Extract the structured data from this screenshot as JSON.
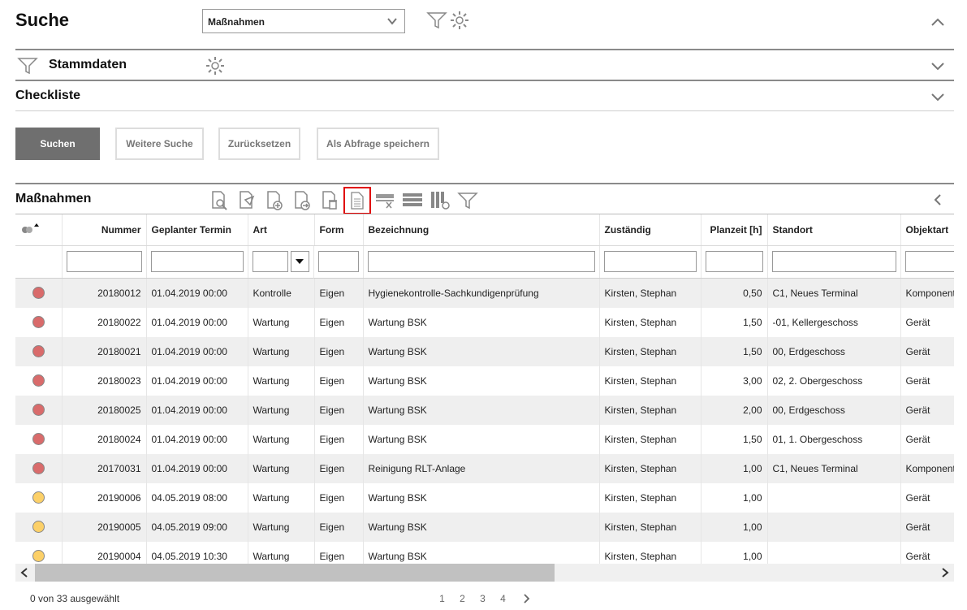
{
  "header": {
    "title": "Suche",
    "select_value": "Maßnahmen"
  },
  "sections": {
    "stammdaten": "Stammdaten",
    "checkliste": "Checkliste"
  },
  "buttons": {
    "suchen": "Suchen",
    "weitere": "Weitere Suche",
    "reset": "Zurücksetzen",
    "save": "Als Abfrage speichern"
  },
  "results": {
    "title": "Maßnahmen",
    "columns": [
      "",
      "Nummer",
      "Geplanter Termin",
      "Art",
      "Form",
      "Bezeichnung",
      "Zuständig",
      "Planzeit [h]",
      "Standort",
      "Objektart"
    ],
    "rows": [
      {
        "status": "red",
        "nummer": "20180012",
        "termin": "01.04.2019 00:00",
        "art": "Kontrolle",
        "form": "Eigen",
        "bez": "Hygienekontrolle-Sachkundigenprüfung",
        "zust": "Kirsten, Stephan",
        "plan": "0,50",
        "standort": "C1, Neues Terminal",
        "objektart": "Komponente"
      },
      {
        "status": "red",
        "nummer": "20180022",
        "termin": "01.04.2019 00:00",
        "art": "Wartung",
        "form": "Eigen",
        "bez": "Wartung BSK",
        "zust": "Kirsten, Stephan",
        "plan": "1,50",
        "standort": "-01, Kellergeschoss",
        "objektart": "Gerät"
      },
      {
        "status": "red",
        "nummer": "20180021",
        "termin": "01.04.2019 00:00",
        "art": "Wartung",
        "form": "Eigen",
        "bez": "Wartung BSK",
        "zust": "Kirsten, Stephan",
        "plan": "1,50",
        "standort": "00, Erdgeschoss",
        "objektart": "Gerät"
      },
      {
        "status": "red",
        "nummer": "20180023",
        "termin": "01.04.2019 00:00",
        "art": "Wartung",
        "form": "Eigen",
        "bez": "Wartung BSK",
        "zust": "Kirsten, Stephan",
        "plan": "3,00",
        "standort": "02, 2. Obergeschoss",
        "objektart": "Gerät"
      },
      {
        "status": "red",
        "nummer": "20180025",
        "termin": "01.04.2019 00:00",
        "art": "Wartung",
        "form": "Eigen",
        "bez": "Wartung BSK",
        "zust": "Kirsten, Stephan",
        "plan": "2,00",
        "standort": "00, Erdgeschoss",
        "objektart": "Gerät"
      },
      {
        "status": "red",
        "nummer": "20180024",
        "termin": "01.04.2019 00:00",
        "art": "Wartung",
        "form": "Eigen",
        "bez": "Wartung BSK",
        "zust": "Kirsten, Stephan",
        "plan": "1,50",
        "standort": "01, 1. Obergeschoss",
        "objektart": "Gerät"
      },
      {
        "status": "red",
        "nummer": "20170031",
        "termin": "01.04.2019 00:00",
        "art": "Wartung",
        "form": "Eigen",
        "bez": "Reinigung RLT-Anlage",
        "zust": "Kirsten, Stephan",
        "plan": "1,00",
        "standort": "C1, Neues Terminal",
        "objektart": "Komponente"
      },
      {
        "status": "yellow",
        "nummer": "20190006",
        "termin": "04.05.2019 08:00",
        "art": "Wartung",
        "form": "Eigen",
        "bez": "Wartung BSK",
        "zust": "Kirsten, Stephan",
        "plan": "1,00",
        "standort": "",
        "objektart": "Gerät"
      },
      {
        "status": "yellow",
        "nummer": "20190005",
        "termin": "04.05.2019 09:00",
        "art": "Wartung",
        "form": "Eigen",
        "bez": "Wartung BSK",
        "zust": "Kirsten, Stephan",
        "plan": "1,00",
        "standort": "",
        "objektart": "Gerät"
      },
      {
        "status": "yellow",
        "nummer": "20190004",
        "termin": "04.05.2019 10:30",
        "art": "Wartung",
        "form": "Eigen",
        "bez": "Wartung BSK",
        "zust": "Kirsten, Stephan",
        "plan": "1,00",
        "standort": "",
        "objektart": "Gerät"
      }
    ]
  },
  "status_colors": {
    "red": "#d96b6b",
    "yellow": "#fcd068"
  },
  "footer": {
    "selected": "0 von 33 ausgewählt",
    "pages": [
      "1",
      "2",
      "3",
      "4"
    ]
  },
  "icons": {
    "toolbar": [
      "view-icon",
      "copy-icon",
      "add-icon",
      "export-icon",
      "delete-icon",
      "document-icon",
      "filter-clear-icon",
      "rows-icon",
      "columns-icon",
      "filter-icon"
    ]
  }
}
